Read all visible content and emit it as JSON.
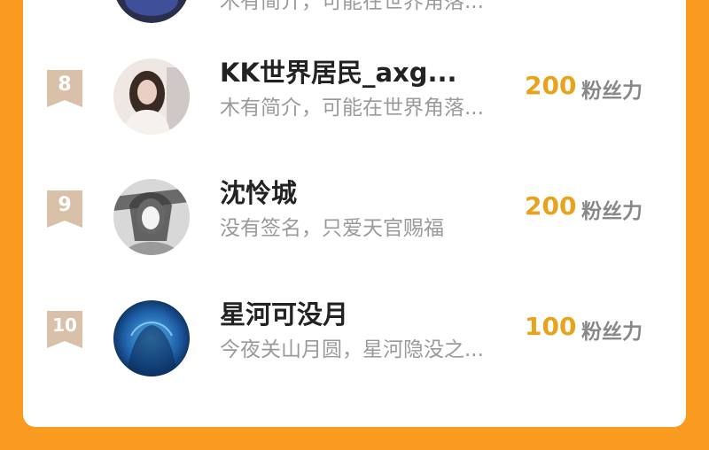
{
  "leaderboard": {
    "top_partial": {
      "bio": "木有简介，可能在世界角落..."
    },
    "entries": [
      {
        "rank": "8",
        "name": "KK世界居民_axg...",
        "bio": "木有简介，可能在世界角落...",
        "score": "200",
        "unit": "粉丝力"
      },
      {
        "rank": "9",
        "name": "沈怜城",
        "bio": "没有签名，只爱天官赐福",
        "score": "200",
        "unit": "粉丝力"
      },
      {
        "rank": "10",
        "name": "星河可没月",
        "bio": "今夜关山月圆，星河隐没之...",
        "score": "100",
        "unit": "粉丝力"
      }
    ]
  },
  "colors": {
    "background": "#f89b1f",
    "card": "#ffffff",
    "score": "#e8a21c",
    "rank_badge": "#d9c0a8"
  }
}
